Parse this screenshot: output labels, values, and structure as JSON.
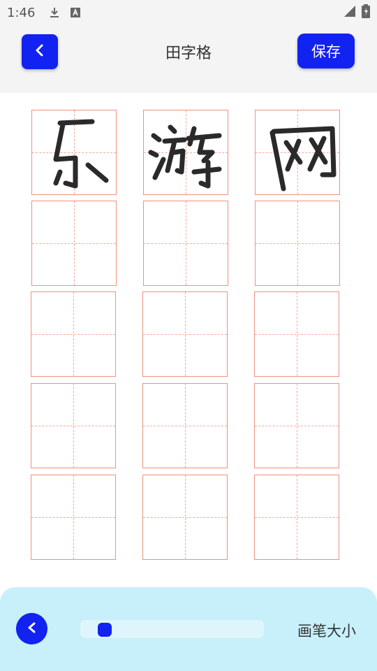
{
  "status_bar": {
    "time": "1:46"
  },
  "header": {
    "title": "田字格",
    "save_label": "保存"
  },
  "grid": {
    "characters": [
      "乐",
      "游",
      "网"
    ]
  },
  "brush": {
    "label": "画笔大小",
    "value_fraction": 0.05
  },
  "colors": {
    "accent": "#1222f0",
    "grid_line": "#f0907f",
    "panel_bg": "#c8f0fa"
  },
  "icons": {
    "back": "chevron-left-icon",
    "download": "download-icon",
    "text": "text-a-icon",
    "signal": "signal-icon",
    "battery": "battery-icon"
  }
}
